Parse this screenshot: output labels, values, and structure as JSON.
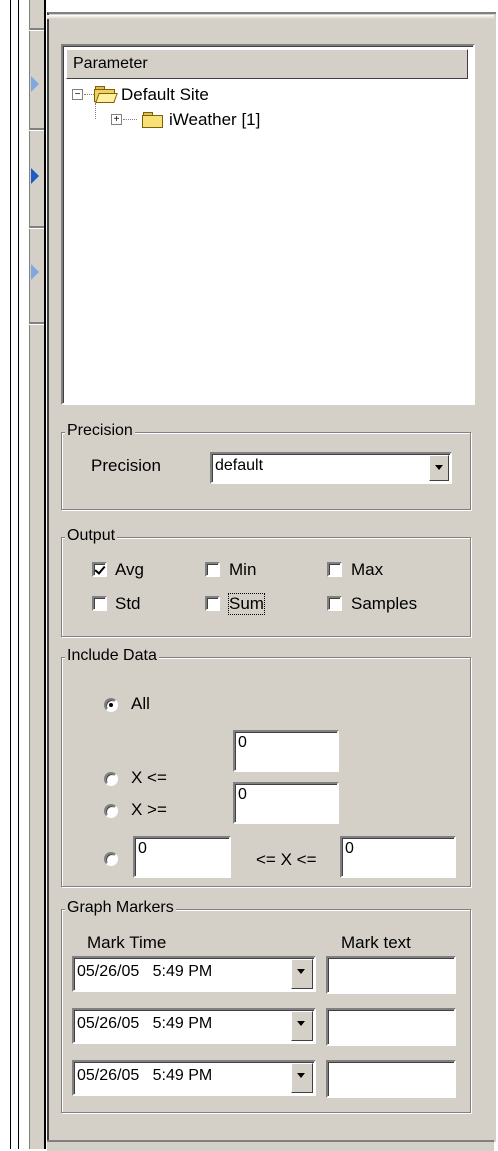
{
  "tree": {
    "header": "Parameter",
    "root": {
      "label": "Default Site",
      "expander": "−"
    },
    "child": {
      "label": "iWeather [1]",
      "expander": "+"
    }
  },
  "precision": {
    "group_title": "Precision",
    "label": "Precision",
    "value": "default"
  },
  "output": {
    "group_title": "Output",
    "items": [
      {
        "label": "Avg",
        "checked": true
      },
      {
        "label": "Min",
        "checked": false
      },
      {
        "label": "Max",
        "checked": false
      },
      {
        "label": "Std",
        "checked": false
      },
      {
        "label": "Sum",
        "checked": false
      },
      {
        "label": "Samples",
        "checked": false
      }
    ]
  },
  "include_data": {
    "group_title": "Include Data",
    "options": [
      {
        "label": "All",
        "selected": true
      },
      {
        "label": "X <=",
        "value": "0",
        "selected": false
      },
      {
        "label": "X >=",
        "value": "0",
        "selected": false
      },
      {
        "low": "0",
        "label": "<= X <=",
        "high": "0",
        "selected": false
      }
    ]
  },
  "graph_markers": {
    "group_title": "Graph Markers",
    "col_time": "Mark Time",
    "col_text": "Mark text",
    "rows": [
      {
        "time": "05/26/05   5:49 PM",
        "text": ""
      },
      {
        "time": "05/26/05   5:49 PM",
        "text": ""
      },
      {
        "time": "05/26/05   5:49 PM",
        "text": ""
      }
    ]
  },
  "colors": {
    "face": "#d4d0c8",
    "shadow": "#808080",
    "arrow_blue": "#4a7fd0"
  }
}
